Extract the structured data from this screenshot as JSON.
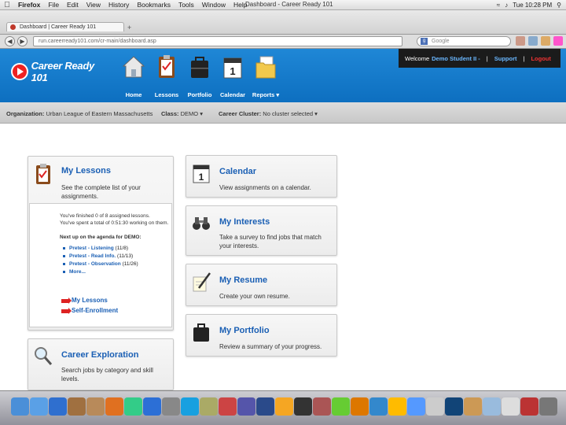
{
  "os_menu": {
    "app": "Firefox",
    "items": [
      "File",
      "Edit",
      "View",
      "History",
      "Bookmarks",
      "Tools",
      "Window",
      "Help"
    ],
    "window_title": "Dashboard - Career Ready 101",
    "clock": "Tue 10:28 PM"
  },
  "browser": {
    "tab_title": "Dashboard | Career Ready 101",
    "url": "run.careerready101.com/cr-main/dashboard.asp",
    "search_placeholder": "Google"
  },
  "site": {
    "logo": "Career Ready 101",
    "nav": [
      {
        "label": "Home",
        "icon": "house-icon"
      },
      {
        "label": "Lessons",
        "icon": "clipboard-icon"
      },
      {
        "label": "Portfolio",
        "icon": "briefcase-icon"
      },
      {
        "label": "Calendar",
        "icon": "calendar-icon"
      },
      {
        "label": "Reports ▾",
        "icon": "folder-icon"
      }
    ],
    "welcome_label": "Welcome",
    "user": "Demo Student II -",
    "support": "Support",
    "logout": "Logout",
    "pipe": "|"
  },
  "org_bar": {
    "org_label": "Organization:",
    "org_value": "Urban League of Eastern Massachusetts",
    "class_label": "Class:",
    "class_value": "DEMO ▾",
    "cluster_label": "Career Cluster:",
    "cluster_value": "No cluster selected ▾"
  },
  "cards": {
    "lessons": {
      "title": "My Lessons",
      "desc": "See the complete list of your assignments.",
      "progress_line1": "You've finished 0 of 8 assigned lessons.",
      "progress_line2": "You've spent a total of 0:51:30 working on them.",
      "agenda_heading": "Next up on the agenda for DEMO:",
      "agenda": [
        {
          "label": "Pretest - Listening",
          "date": "(11/8)"
        },
        {
          "label": "Pretest - Read Info.",
          "date": "(11/13)"
        },
        {
          "label": "Pretest - Observation",
          "date": "(11/26)"
        },
        {
          "label": "More...",
          "date": ""
        }
      ],
      "link1": "My Lessons",
      "link2": "Self-Enrollment"
    },
    "calendar": {
      "title": "Calendar",
      "desc": "View assignments on a calendar."
    },
    "interests": {
      "title": "My Interests",
      "desc": "Take a survey to find jobs that match your interests."
    },
    "resume": {
      "title": "My Resume",
      "desc": "Create your own resume."
    },
    "portfolio": {
      "title": "My Portfolio",
      "desc": "Review a summary of your progress."
    },
    "exploration": {
      "title": "Career Exploration",
      "desc": "Search jobs by category and skill levels."
    }
  },
  "colors": {
    "header_blue": "#1f87d6",
    "link_blue": "#1a5fb4",
    "logout_red": "#e33"
  }
}
